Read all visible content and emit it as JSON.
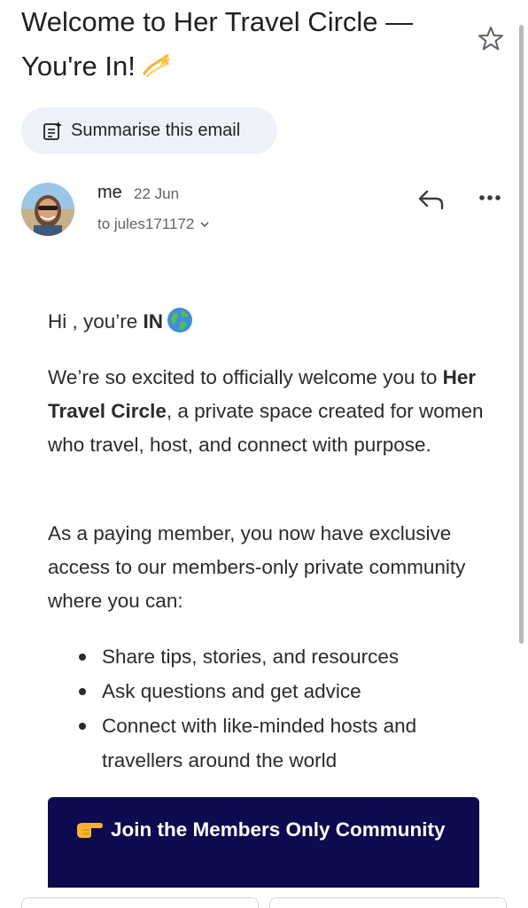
{
  "email": {
    "subject": "Welcome to Her Travel Circle — You're In!",
    "summarise_label": "Summarise this email",
    "sender": "me",
    "date": "22 Jun",
    "recipient": "to jules171172"
  },
  "body": {
    "greeting_prefix": "Hi , you’re ",
    "greeting_bold": "IN",
    "para1_a": "We’re so excited to officially welcome you to ",
    "para1_bold": "Her Travel Circle",
    "para1_b": ", a private space created for women who travel, host, and connect with purpose.",
    "para2": "As a paying member, you now have exclusive access to our members-only private community where you can:",
    "bullets": [
      "Share tips, stories, and resources",
      "Ask questions and get advice",
      "Connect with like-minded hosts and travellers around the world"
    ],
    "cta_label": "Join the Members Only Community"
  },
  "icons": {
    "star": "star-icon",
    "summarise": "summarise-icon",
    "reply": "reply-icon",
    "more": "more-icon",
    "globe": "globe-emoji",
    "sparkle": "dizzy-emoji",
    "hand": "pointing-hand-emoji"
  },
  "colors": {
    "cta_background": "#0d0a4f",
    "summarise_background": "#eef2f8",
    "secondary_text": "#5f6368"
  }
}
